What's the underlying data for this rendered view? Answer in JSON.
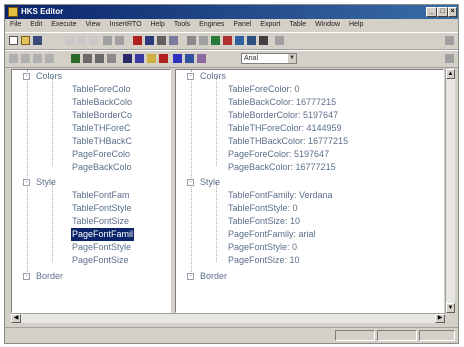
{
  "window": {
    "title": "HKS Editor"
  },
  "menu": [
    "File",
    "Edit",
    "Execute",
    "View",
    "InsertRTO",
    "Help",
    "Tools",
    "Engines",
    "Panel",
    "Export",
    "Table",
    "Window",
    "Help"
  ],
  "toolbar2": {
    "font_size": "Arial"
  },
  "left_tree": {
    "group_colors": "Colors",
    "colors_items": [
      "TableForeColo",
      "TableBackColo",
      "TableBorderCo",
      "TableTHForeC",
      "TableTHBackC",
      "PageForeColo",
      "PageBackColo"
    ],
    "group_style": "Style",
    "style_items": [
      "TableFontFam",
      "TableFontStyle",
      "TableFontSize",
      "PageFontFamil",
      "PageFontStyle",
      "PageFontSize"
    ],
    "group_border": "Border"
  },
  "right_tree": {
    "group_colors": "Colors",
    "colors_items": [
      "TableForeColor: 0",
      "TableBackColor: 16777215",
      "TableBorderColor: 5197647",
      "TableTHForeColor: 4144959",
      "TableTHBackColor: 16777215",
      "PageForeColor: 5197647",
      "PageBackColor: 16777215"
    ],
    "group_style": "Style",
    "style_items": [
      "TableFontFamily: Verdana",
      "TableFontStyle: 0",
      "TableFontSize: 10",
      "PageFontFamily: arial",
      "PageFontStyle: 0",
      "PageFontSize: 10"
    ],
    "group_border": "Border"
  },
  "colors": {
    "title_bar": "#0a246a",
    "selection": "#0a246a",
    "tree_text": "#5b6f8a"
  }
}
